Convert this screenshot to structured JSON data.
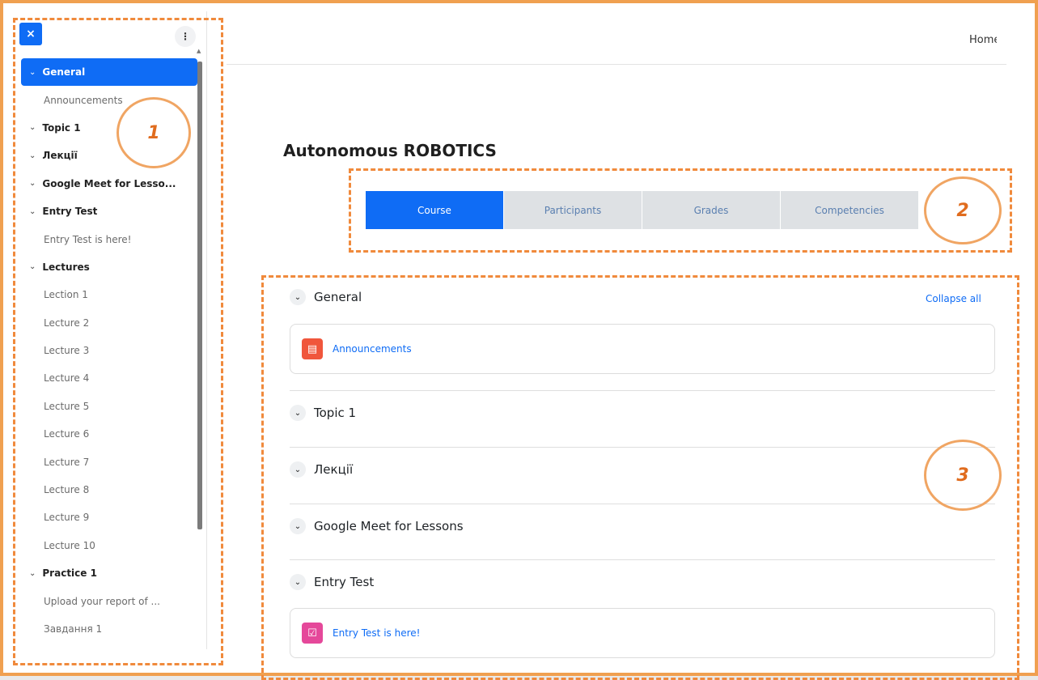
{
  "drawer": {
    "close_label": "×",
    "menu_label": "⋮",
    "items": [
      {
        "label": "General",
        "type": "section",
        "active": true
      },
      {
        "label": "Announcements",
        "type": "activity"
      },
      {
        "label": "Topic 1",
        "type": "section"
      },
      {
        "label": "Лекції",
        "type": "section"
      },
      {
        "label": "Google Meet for Lesso...",
        "type": "section"
      },
      {
        "label": "Entry Test",
        "type": "section"
      },
      {
        "label": "Entry Test is here!",
        "type": "activity"
      },
      {
        "label": "Lectures",
        "type": "section"
      },
      {
        "label": "Lection 1",
        "type": "activity"
      },
      {
        "label": "Lecture 2",
        "type": "activity"
      },
      {
        "label": "Lecture 3",
        "type": "activity"
      },
      {
        "label": "Lecture 4",
        "type": "activity"
      },
      {
        "label": "Lecture 5",
        "type": "activity"
      },
      {
        "label": "Lecture 6",
        "type": "activity"
      },
      {
        "label": "Lecture 7",
        "type": "activity"
      },
      {
        "label": "Lecture 8",
        "type": "activity"
      },
      {
        "label": "Lecture 9",
        "type": "activity"
      },
      {
        "label": "Lecture 10",
        "type": "activity"
      },
      {
        "label": "Practice 1",
        "type": "section"
      },
      {
        "label": "Upload your report of ...",
        "type": "activity"
      },
      {
        "label": "Завдання 1",
        "type": "activity"
      }
    ]
  },
  "header": {
    "home_label": "Home"
  },
  "course": {
    "title": "Autonomous ROBOTICS"
  },
  "tabs": [
    {
      "label": "Course",
      "active": true
    },
    {
      "label": "Participants"
    },
    {
      "label": "Grades"
    },
    {
      "label": "Competencies"
    }
  ],
  "content": {
    "collapse_all": "Collapse all",
    "sections": {
      "general": "General",
      "topic1": "Topic 1",
      "lektsii": "Лекції",
      "google_meet": "Google Meet for Lessons",
      "entry_test": "Entry Test"
    },
    "activities": {
      "announcements": {
        "label": "Announcements",
        "icon": "forum-icon",
        "color": "#f0563c"
      },
      "entry_test": {
        "label": "Entry Test is here!",
        "icon": "assignment-icon",
        "color": "#e5489a"
      }
    }
  },
  "annotations": {
    "one": "1",
    "two": "2",
    "three": "3"
  },
  "colors": {
    "accent": "#0f6cf5",
    "annotation": "#f08a3c"
  }
}
